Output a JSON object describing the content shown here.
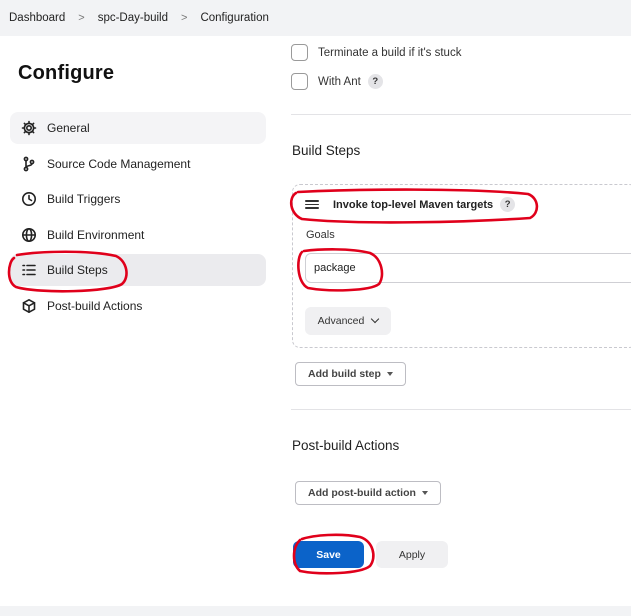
{
  "breadcrumb": {
    "items": [
      "Dashboard",
      "spc-Day-build",
      "Configuration"
    ],
    "separator": ">"
  },
  "sidebar": {
    "title": "Configure",
    "items": [
      {
        "label": "General",
        "icon": "gear-icon"
      },
      {
        "label": "Source Code Management",
        "icon": "branch-icon"
      },
      {
        "label": "Build Triggers",
        "icon": "clock-icon"
      },
      {
        "label": "Build Environment",
        "icon": "globe-icon"
      },
      {
        "label": "Build Steps",
        "icon": "list-icon",
        "active": true
      },
      {
        "label": "Post-build Actions",
        "icon": "cube-icon"
      }
    ]
  },
  "build_environment": {
    "options": [
      {
        "label": "Terminate a build if it's stuck",
        "checked": false
      },
      {
        "label": "With Ant",
        "checked": false,
        "help": "?"
      }
    ]
  },
  "build_steps": {
    "heading": "Build Steps",
    "step": {
      "title": "Invoke top-level Maven targets",
      "help": "?",
      "goals_label": "Goals",
      "goals_value": "package",
      "advanced_label": "Advanced"
    },
    "add_label": "Add build step"
  },
  "post_build": {
    "heading": "Post-build Actions",
    "add_label": "Add post-build action"
  },
  "actions": {
    "save_label": "Save",
    "apply_label": "Apply"
  },
  "colors": {
    "primary": "#0b63c9",
    "annotation": "#e0001b",
    "active_bg": "#ebebee"
  }
}
